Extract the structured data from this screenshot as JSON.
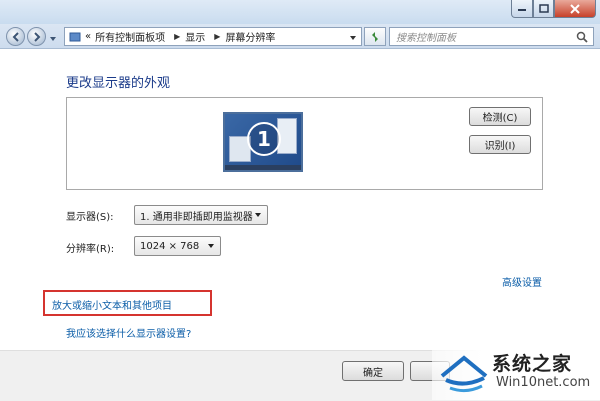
{
  "nav": {
    "address": {
      "prefix": "«",
      "segments": [
        "所有控制面板项",
        "显示",
        "屏幕分辨率"
      ]
    },
    "search_placeholder": "搜索控制面板"
  },
  "content": {
    "title": "更改显示器的外观",
    "monitor_number": "1",
    "buttons": {
      "detect": "检测(C)",
      "identify": "识别(I)"
    },
    "display": {
      "label": "显示器(S):",
      "value": "1. 通用非即插即用监视器"
    },
    "resolution": {
      "label": "分辨率(R):",
      "value": "1024 × 768"
    },
    "links": {
      "advanced": "高级设置",
      "enlarge": "放大或缩小文本和其他项目",
      "which": "我应该选择什么显示器设置?"
    }
  },
  "footer": {
    "ok": "确定",
    "cancel": ""
  },
  "watermark": {
    "title": "系统之家",
    "sub": "Win10net.com"
  },
  "colors": {
    "link": "#0c5ea8",
    "title": "#1b3b8a",
    "highlight": "#d5342f"
  }
}
